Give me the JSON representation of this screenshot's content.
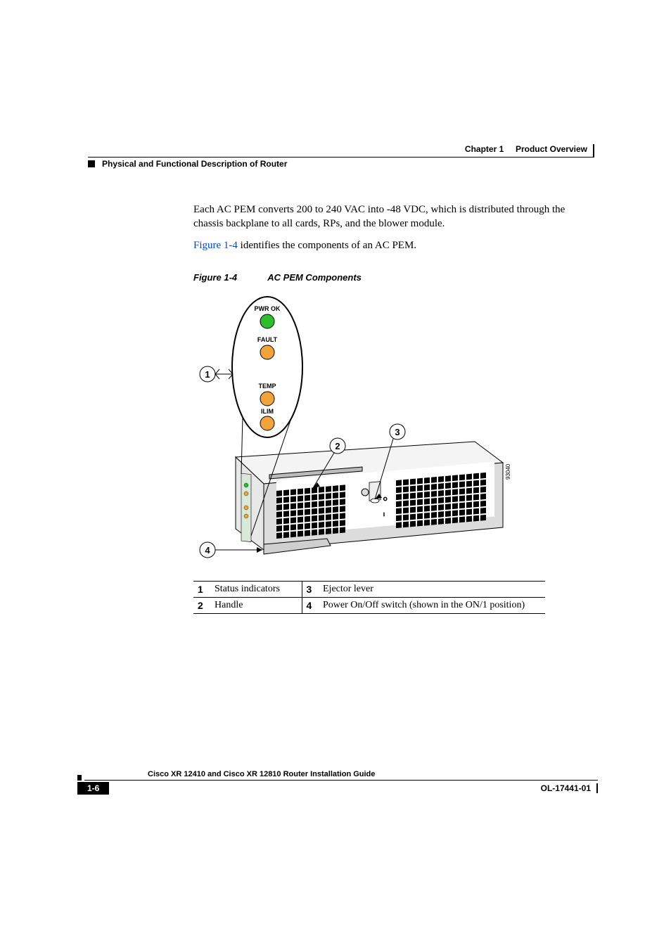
{
  "header": {
    "chapter_label": "Chapter 1",
    "chapter_title": "Product Overview",
    "section_title": "Physical and Functional Description of Router"
  },
  "body": {
    "para1": "Each AC PEM converts 200 to 240 VAC into -48 VDC, which is distributed through the chassis backplane to all cards, RPs, and the blower module.",
    "para2_link": "Figure 1-4",
    "para2_rest": " identifies the components of an AC PEM.",
    "figure": {
      "number": "Figure 1-4",
      "title": "AC PEM Components",
      "labels": {
        "pwr_ok": "PWR OK",
        "fault": "FAULT",
        "temp": "TEMP",
        "ilim": "ILIM"
      },
      "callout_numbers": [
        "1",
        "2",
        "3",
        "4"
      ],
      "side_id": "93040"
    },
    "callouts": [
      {
        "n": "1",
        "text": "Status indicators"
      },
      {
        "n": "2",
        "text": "Handle"
      },
      {
        "n": "3",
        "text": "Ejector lever"
      },
      {
        "n": "4",
        "text": "Power On/Off switch (shown in the ON/1 position)"
      }
    ]
  },
  "footer": {
    "guide_title": "Cisco XR 12410 and Cisco XR 12810 Router Installation Guide",
    "page_number": "1-6",
    "doc_number": "OL-17441-01"
  }
}
